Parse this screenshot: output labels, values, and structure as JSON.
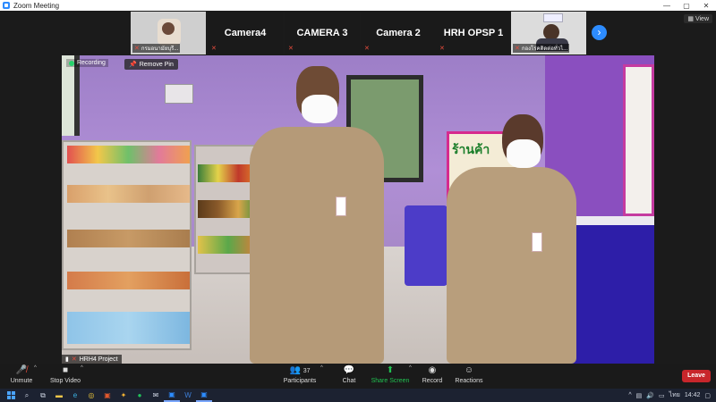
{
  "window": {
    "title": "Zoom Meeting"
  },
  "header": {
    "view_label": "View"
  },
  "gallery": [
    {
      "type": "video",
      "name": "กรมอนามัยบุรี..."
    },
    {
      "type": "label",
      "label": "Camera4"
    },
    {
      "type": "label",
      "label": "CAMERA 3"
    },
    {
      "type": "label",
      "label": "Camera 2"
    },
    {
      "type": "label",
      "label": "HRH OPSP 1"
    },
    {
      "type": "video",
      "name": "กองโรคติดต่อทั่วไ..."
    }
  ],
  "main_video": {
    "recording_label": "Recording",
    "remove_pin_label": "Remove Pin",
    "participant_name": "HRH4 Project",
    "poster_text": "ร้านค้า"
  },
  "toolbar": {
    "unmute": "Unmute",
    "stop_video": "Stop Video",
    "participants": "Participants",
    "participants_count": "37",
    "chat": "Chat",
    "share_screen": "Share Screen",
    "record": "Record",
    "reactions": "Reactions",
    "leave": "Leave"
  },
  "taskbar": {
    "lang": "ไทย",
    "time": "14:42"
  },
  "colors": {
    "accent": "#2d8cff",
    "leave": "#c8262b",
    "share": "#20c050",
    "muted": "#e74c3c"
  }
}
